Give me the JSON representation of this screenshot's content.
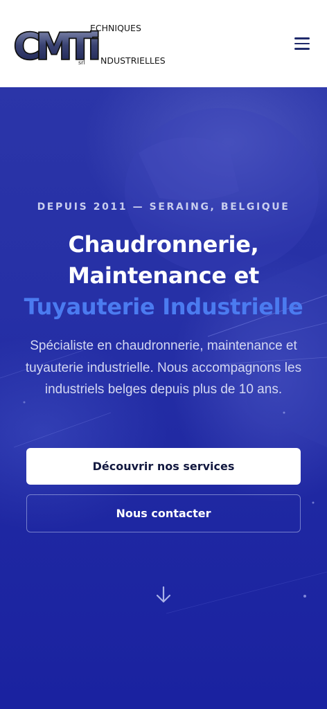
{
  "header": {
    "logo": {
      "monogram": "CMTi",
      "line1": "ECHNIQUES",
      "line2": "NDUSTRIELLES",
      "suffix": "srl"
    },
    "menu_icon": "hamburger-menu-icon"
  },
  "hero": {
    "eyebrow": "DEPUIS 2011 — SERAING, BELGIQUE",
    "title_line1": "Chaudronnerie,",
    "title_line2": "Maintenance et",
    "title_accent": "Tuyauterie Industrielle",
    "lead": "Spécialiste en chaudronnerie, maintenance et tuyauterie industrielle. Nous accompagnons les industriels belges depuis plus de 10 ans.",
    "primary_button": "Découvrir nos services",
    "secondary_button": "Nous contacter",
    "scroll_icon": "arrow-down-icon"
  },
  "colors": {
    "accent": "#4b7bf0",
    "hero_bg": "#2630a6",
    "logo_navy": "#1f2a6b"
  }
}
